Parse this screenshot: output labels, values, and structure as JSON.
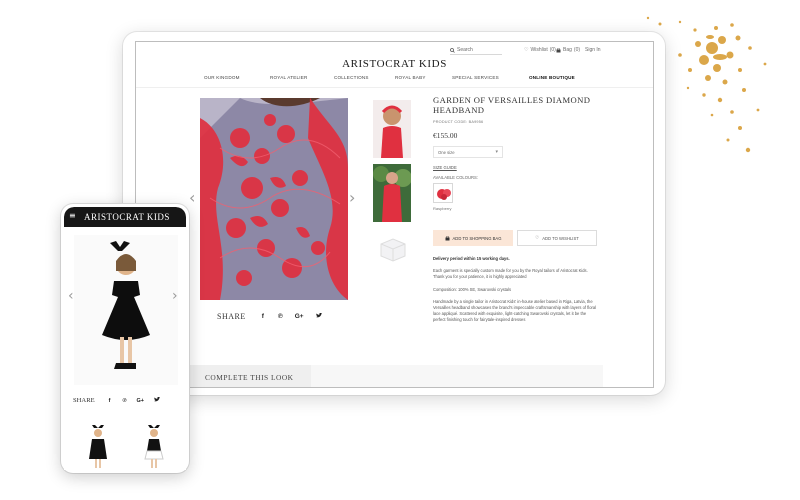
{
  "brand": "ARISTOCRAT KIDS",
  "utility": {
    "search_placeholder": "Search",
    "wishlist_label": "Wishlist",
    "wishlist_count": "(0)",
    "bag_label": "Bag",
    "bag_count": "(0)",
    "signin_label": "Sign In"
  },
  "nav": [
    "OUR KINGDOM",
    "ROYAL ATELIER",
    "COLLECTIONS",
    "ROYAL BABY",
    "SPECIAL SERVICES",
    "ONLINE BOUTIQUE"
  ],
  "product": {
    "title": "GARDEN OF VERSAILLES DIAMOND HEADBAND",
    "code": "PRODUCT CODE: BA9956",
    "price": "€155.00",
    "size_selected": "One size",
    "size_guide": "SIZE GUIDE",
    "colours_label": "AVAILABLE COLOURS:",
    "colour_name": "Raspberry",
    "add_to_bag": "ADD TO SHOPPING BAG",
    "add_to_wishlist": "ADD TO WISHLIST",
    "delivery": "Delivery period within 15 working days.",
    "desc_1": "Each garment is specially custom made for you by the Royal tailors of Aristocrat Kids. Thank you for your patience, it is highly appreciated",
    "composition": "Composition: 100% SE, Swarovski crystals",
    "desc_2": "Handmade by a single tailor in Aristocrat Kids' in-house atelier based in Riga, Latvia, the Versailles headband showcases the brand's impeccable craftsmanship with layers of floral lace appliqué. Scattered with exquisite, light-catching Swarovski crystals, let it be the perfect finishing touch for fairytale-inspired dresses"
  },
  "share_label": "SHARE",
  "share_icons": [
    "f",
    "℗",
    "G+",
    "✦"
  ],
  "complete_look": "COMPLETE THIS LOOK",
  "colors": {
    "lace_red": "#e03040",
    "gold": "#d9a441",
    "bag_button_bg": "#fbe6d7",
    "phone_header": "#161616"
  }
}
